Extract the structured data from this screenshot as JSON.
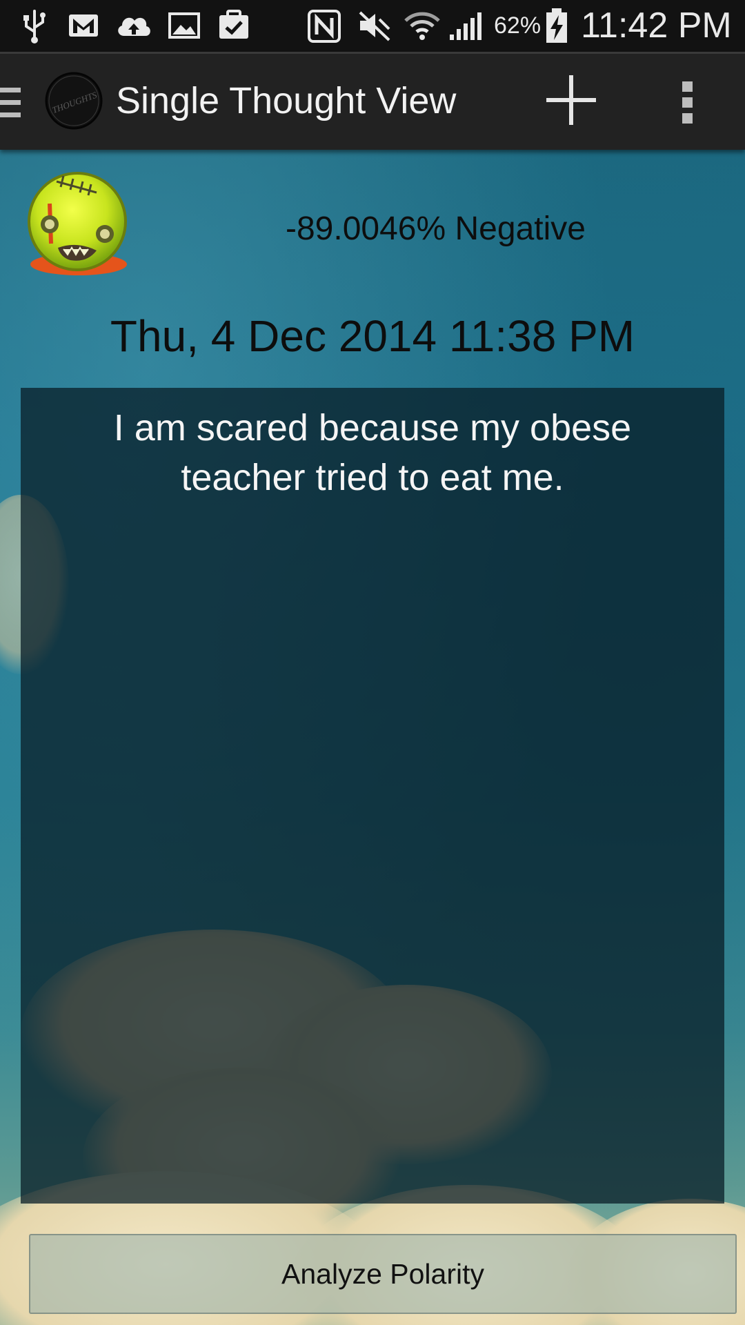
{
  "status_bar": {
    "icons": [
      "usb-icon",
      "gmail-icon",
      "cloud-upload-icon",
      "gallery-icon",
      "clipboard-check-icon",
      "nfc-icon",
      "mute-icon",
      "wifi-icon",
      "signal-icon",
      "battery-charging-icon"
    ],
    "battery_percent": "62%",
    "time": "11:42 PM"
  },
  "action_bar": {
    "title": "Single Thought View",
    "logo_text": "THOUGHTS",
    "icons": [
      "drawer-icon",
      "app-logo-icon",
      "add-icon",
      "overflow-menu-icon"
    ]
  },
  "thought": {
    "mood_icon": "zombie-face-icon",
    "polarity": "-89.0046% Negative",
    "timestamp": "Thu, 4 Dec 2014 11:38 PM",
    "text": "I am scared because my obese teacher tried to eat me."
  },
  "actions": {
    "analyze_label": "Analyze Polarity"
  },
  "colors": {
    "status_bar_bg": "#121212",
    "action_bar_bg": "#222222",
    "panel_bg": "#0b2430",
    "text_dark": "#0d0d0d",
    "text_light": "#f5f5f5"
  }
}
